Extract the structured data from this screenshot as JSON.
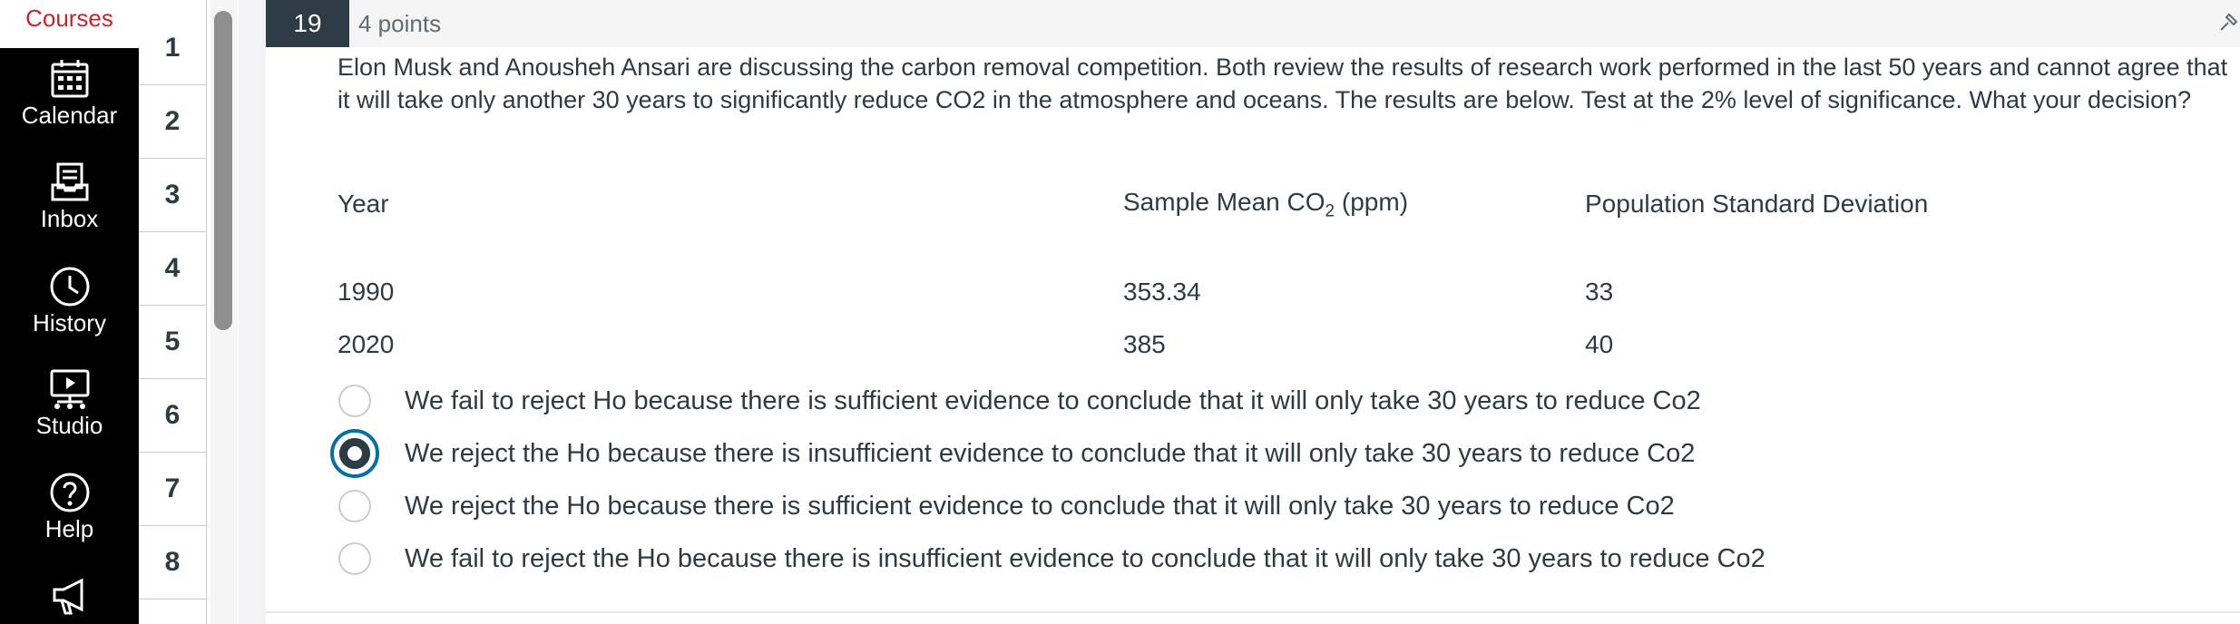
{
  "nav": {
    "courses_label": "Courses",
    "items": [
      {
        "label": "Calendar",
        "icon": "calendar-icon"
      },
      {
        "label": "Inbox",
        "icon": "inbox-icon"
      },
      {
        "label": "History",
        "icon": "clock-icon"
      },
      {
        "label": "Studio",
        "icon": "studio-icon"
      },
      {
        "label": "Help",
        "icon": "help-icon"
      },
      {
        "label": "",
        "icon": "megaphone-icon"
      }
    ]
  },
  "question_nav": {
    "numbers": [
      "1",
      "2",
      "3",
      "4",
      "5",
      "6",
      "7",
      "8"
    ]
  },
  "question": {
    "number": "19",
    "points": "4 points",
    "text": "Elon Musk and Anousheh Ansari are discussing the carbon removal competition. Both review the results of research work performed in the last 50 years and cannot agree that it will take only another 30 years to significantly reduce CO2 in the atmosphere and oceans. The results are below. Test at the 2% level of significance. What your decision?",
    "table": {
      "headers": {
        "year": "Year",
        "mean_prefix": "Sample Mean CO",
        "mean_sub": "2",
        "mean_suffix": " (ppm)",
        "sd": "Population Standard Deviation"
      },
      "rows": [
        {
          "year": "1990",
          "mean": "353.34",
          "sd": "33"
        },
        {
          "year": "2020",
          "mean": "385",
          "sd": "40"
        }
      ]
    },
    "answers": [
      {
        "label": "We fail to reject Ho because there is sufficient evidence to conclude that it will only take 30 years to reduce Co2",
        "selected": false
      },
      {
        "label": "We reject the Ho because there is insufficient evidence to conclude that it will only take 30 years to reduce Co2",
        "selected": true
      },
      {
        "label": "We reject the Ho because there is sufficient evidence to conclude that it will only take 30 years to reduce Co2",
        "selected": false
      },
      {
        "label": "We fail to reject the Ho because there is insufficient evidence to conclude that it will only take 30 years to reduce Co2",
        "selected": false
      }
    ]
  },
  "colors": {
    "nav_bg": "#000000",
    "brand_red": "#c1272d",
    "accent_blue": "#0770a3",
    "text": "#2d3b45"
  }
}
